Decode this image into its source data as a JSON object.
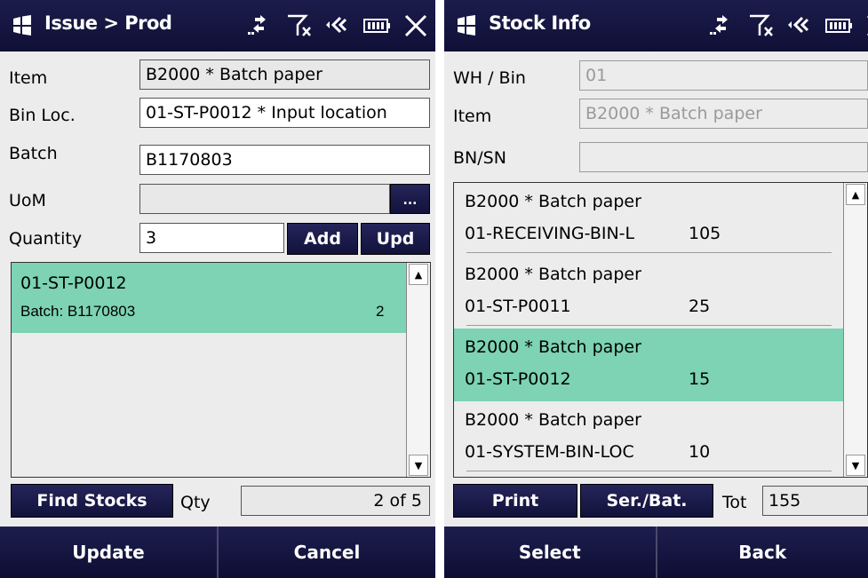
{
  "left": {
    "title": "Issue > Prod",
    "labels": {
      "item": "Item",
      "bin_loc": "Bin Loc.",
      "batch": "Batch",
      "uom": "UoM",
      "quantity": "Quantity",
      "qty": "Qty"
    },
    "values": {
      "item": "B2000 * Batch paper",
      "bin_loc": "01-ST-P0012 * Input location",
      "batch": "B1170803",
      "uom": "",
      "quantity": "3",
      "qty_counter": "2 of 5"
    },
    "buttons": {
      "ellipsis": "...",
      "add": "Add",
      "upd": "Upd",
      "find_stocks": "Find Stocks"
    },
    "list": [
      {
        "bin": "01-ST-P0012",
        "batch_label": "Batch: B1170803",
        "qty": "2",
        "selected": true
      }
    ],
    "softkeys": {
      "left": "Update",
      "right": "Cancel"
    }
  },
  "right": {
    "title": "Stock Info",
    "labels": {
      "wh_bin": "WH / Bin",
      "item": "Item",
      "bnsn": "BN/SN",
      "tot": "Tot"
    },
    "values": {
      "wh_bin": "01",
      "item": "B2000 * Batch paper",
      "bnsn": "",
      "tot": "155"
    },
    "buttons": {
      "print": "Print",
      "ser_bat": "Ser./Bat."
    },
    "list": [
      {
        "name": "B2000 * Batch paper",
        "bin": "01-RECEIVING-BIN-L",
        "qty": "105",
        "selected": false
      },
      {
        "name": "B2000 * Batch paper",
        "bin": "01-ST-P0011",
        "qty": "25",
        "selected": false
      },
      {
        "name": "B2000 * Batch paper",
        "bin": "01-ST-P0012",
        "qty": "15",
        "selected": true
      },
      {
        "name": "B2000 * Batch paper",
        "bin": "01-SYSTEM-BIN-LOC",
        "qty": "10",
        "selected": false
      }
    ],
    "softkeys": {
      "left": "Select",
      "right": "Back"
    }
  },
  "colors": {
    "titlebar": "#13133f",
    "selection": "#7dd3b3",
    "background": "#ececec"
  },
  "icons": [
    "windows-flag-icon",
    "connectivity-icon",
    "signal-off-icon",
    "speaker-muted-icon",
    "battery-icon",
    "close-icon"
  ]
}
